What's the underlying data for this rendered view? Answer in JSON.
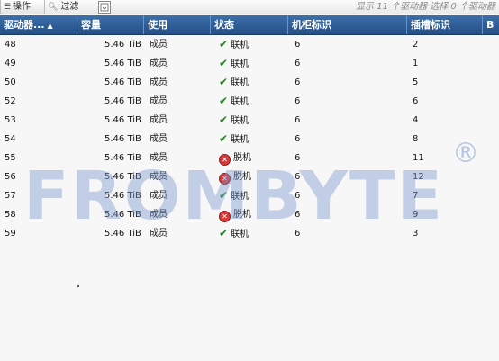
{
  "toolbar": {
    "ops_label": "操作",
    "ops_icon": "menu-icon",
    "filter_label": "过滤",
    "filter_icon": "search-icon",
    "export_icon": "export-icon",
    "status_text": "显示 11 个驱动器 选择 0 个驱动器"
  },
  "table": {
    "headers": {
      "drive": "驱动器...",
      "capacity": "容量",
      "usage": "使用",
      "status": "状态",
      "cabinet": "机柜标识",
      "slot": "插槽标识",
      "extra": "B"
    },
    "rows": [
      {
        "id": "48",
        "capacity": "5.46 TiB",
        "usage": "成员",
        "status": "联机",
        "state": "ok",
        "cabinet": "6",
        "slot": "2"
      },
      {
        "id": "49",
        "capacity": "5.46 TiB",
        "usage": "成员",
        "status": "联机",
        "state": "ok",
        "cabinet": "6",
        "slot": "1"
      },
      {
        "id": "50",
        "capacity": "5.46 TiB",
        "usage": "成员",
        "status": "联机",
        "state": "ok",
        "cabinet": "6",
        "slot": "5"
      },
      {
        "id": "52",
        "capacity": "5.46 TiB",
        "usage": "成员",
        "status": "联机",
        "state": "ok",
        "cabinet": "6",
        "slot": "6"
      },
      {
        "id": "53",
        "capacity": "5.46 TiB",
        "usage": "成员",
        "status": "联机",
        "state": "ok",
        "cabinet": "6",
        "slot": "4"
      },
      {
        "id": "54",
        "capacity": "5.46 TiB",
        "usage": "成员",
        "status": "联机",
        "state": "ok",
        "cabinet": "6",
        "slot": "8"
      },
      {
        "id": "55",
        "capacity": "5.46 TiB",
        "usage": "成员",
        "status": "脱机",
        "state": "bad",
        "cabinet": "6",
        "slot": "11"
      },
      {
        "id": "56",
        "capacity": "5.46 TiB",
        "usage": "成员",
        "status": "脱机",
        "state": "bad",
        "cabinet": "6",
        "slot": "12"
      },
      {
        "id": "57",
        "capacity": "5.46 TiB",
        "usage": "成员",
        "status": "联机",
        "state": "ok",
        "cabinet": "6",
        "slot": "7"
      },
      {
        "id": "58",
        "capacity": "5.46 TiB",
        "usage": "成员",
        "status": "脱机",
        "state": "bad",
        "cabinet": "6",
        "slot": "9"
      },
      {
        "id": "59",
        "capacity": "5.46 TiB",
        "usage": "成员",
        "status": "联机",
        "state": "ok",
        "cabinet": "6",
        "slot": "3"
      }
    ]
  },
  "watermark": {
    "text": "FROMBYTE",
    "mark": "®"
  },
  "colors": {
    "header": "#2d5c96",
    "online": "#1d8a1d",
    "offline": "#d83a3a"
  }
}
